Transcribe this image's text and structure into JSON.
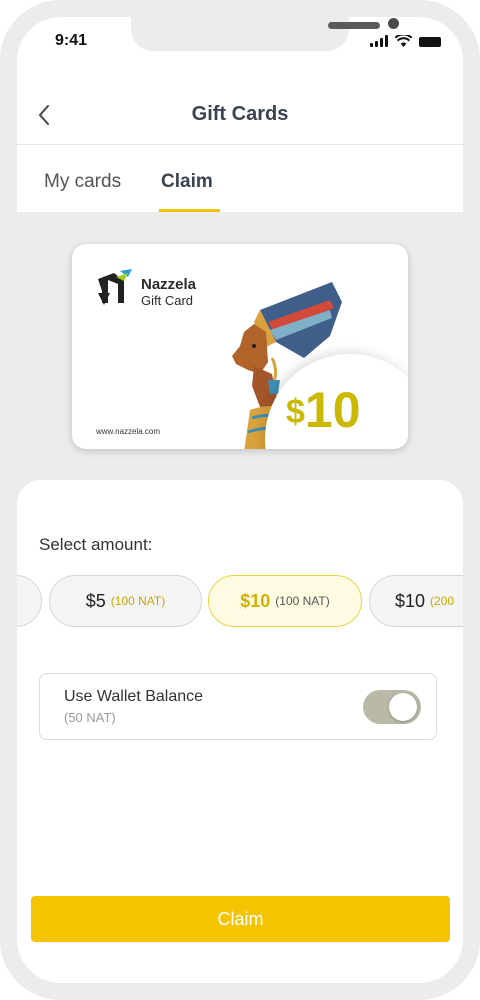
{
  "status_bar": {
    "time": "9:41"
  },
  "header": {
    "title": "Gift Cards"
  },
  "tabs": [
    {
      "label": "My cards",
      "active": false
    },
    {
      "label": "Claim",
      "active": true
    }
  ],
  "gift_card": {
    "brand_name": "Nazzela",
    "brand_sub": "Gift Card",
    "url": "www.nazzela.com",
    "currency_symbol": "$",
    "amount": "10"
  },
  "select_amount": {
    "label": "Select amount:",
    "options": [
      {
        "amount": "$5",
        "nat": "(100 NAT)",
        "selected": false
      },
      {
        "amount": "$10",
        "nat": "(100 NAT)",
        "selected": true
      },
      {
        "amount": "$10",
        "nat": "(200",
        "selected": false
      }
    ]
  },
  "wallet": {
    "label": "Use Wallet Balance",
    "balance": "(50 NAT)",
    "enabled": true
  },
  "claim_button": {
    "label": "Claim"
  },
  "colors": {
    "accent": "#f5c400",
    "amount_gold": "#cbb800",
    "title_text": "#3a4350"
  }
}
